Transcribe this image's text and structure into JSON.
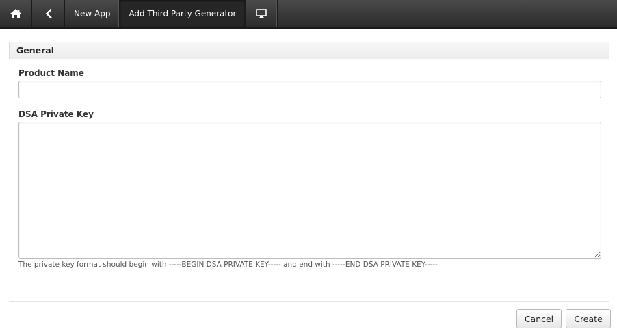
{
  "nav": {
    "home_icon": "home-icon",
    "back_icon": "chevron-left-icon",
    "crumbs": [
      "New App",
      "Add Third Party Generator"
    ],
    "screen_icon": "monitor-icon"
  },
  "form": {
    "section_title": "General",
    "product_name_label": "Product Name",
    "product_name_value": "",
    "dsa_key_label": "DSA Private Key",
    "dsa_key_value": "",
    "help_text": "The private key format should begin with -----BEGIN DSA PRIVATE KEY----- and end with -----END DSA PRIVATE KEY-----"
  },
  "actions": {
    "cancel_label": "Cancel",
    "create_label": "Create"
  }
}
